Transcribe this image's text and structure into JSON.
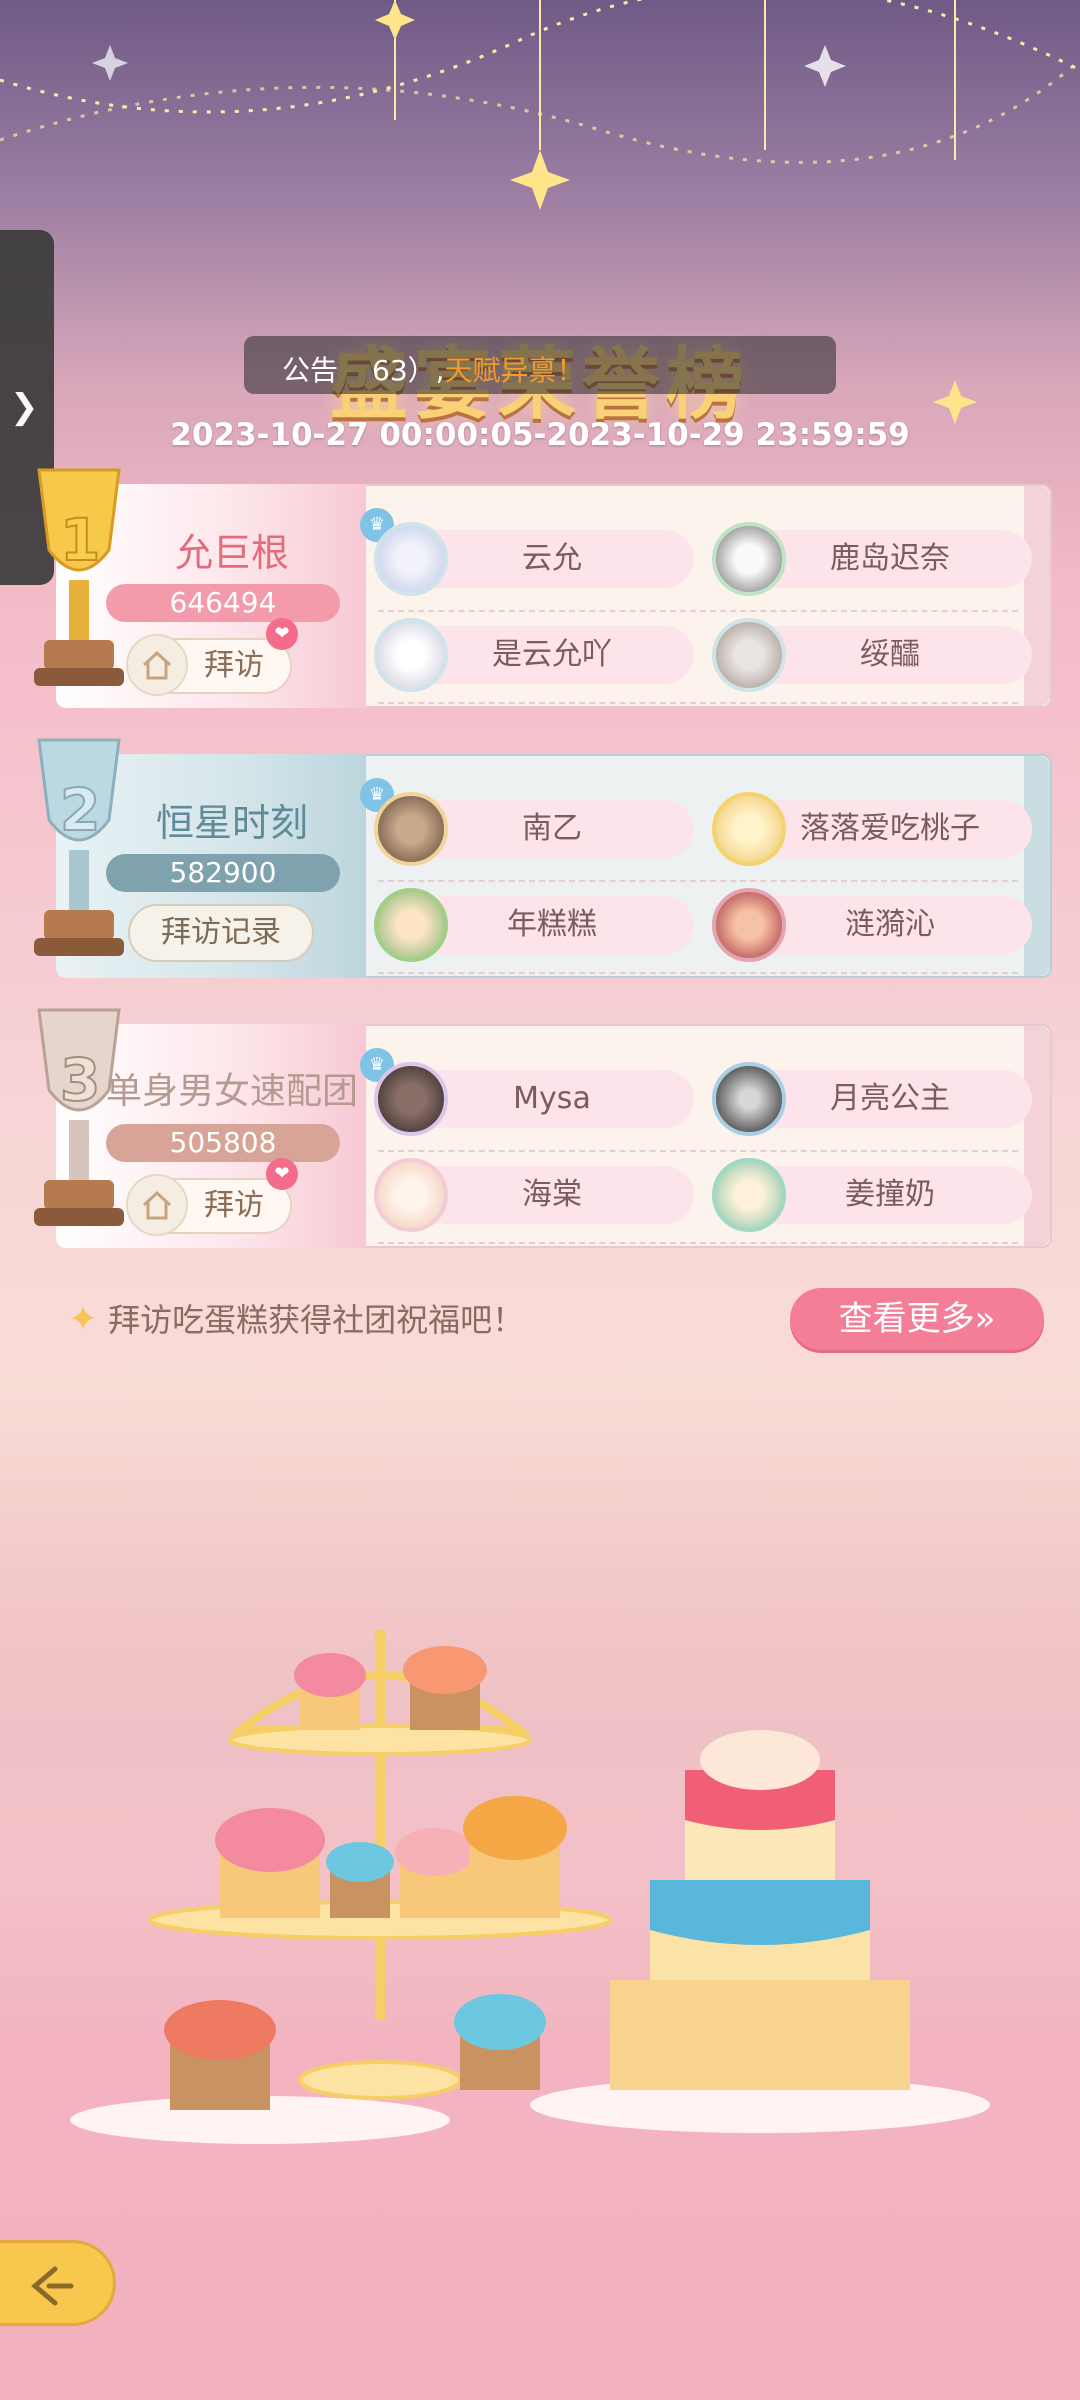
{
  "notice": {
    "label": "公告",
    "text_prefix": "63）,",
    "text_highlight": "天赋异禀！"
  },
  "title": "盛宴荣誉榜",
  "date_range": "2023-10-27 00:00:05-2023-10-29 23:59:59",
  "ranks": [
    {
      "rank": "1",
      "club_name": "允巨根",
      "score": "646494",
      "button": "拜访",
      "members": [
        "云允",
        "鹿岛迟奈",
        "是云允吖",
        "绥醽"
      ]
    },
    {
      "rank": "2",
      "club_name": "恒星时刻",
      "score": "582900",
      "button": "拜访记录",
      "members": [
        "南乙",
        "落落爱吃桃子",
        "年糕糕",
        "涟漪沁"
      ]
    },
    {
      "rank": "3",
      "club_name": "单身男女速配团",
      "score": "505808",
      "button": "拜访",
      "members": [
        "Mysa",
        "月亮公主",
        "海棠",
        "姜撞奶"
      ]
    }
  ],
  "tip": "拜访吃蛋糕获得社团祝福吧！",
  "more_button": "查看更多»",
  "icons": {
    "side_tab": "chevron-right-icon",
    "back": "back-arrow-icon",
    "home": "home-icon",
    "heart": "heart-icon",
    "leader": "leader-icon",
    "star": "sparkle-icon"
  },
  "colors": {
    "accent_pink": "#f47d98",
    "gold": "#f7c84d"
  }
}
